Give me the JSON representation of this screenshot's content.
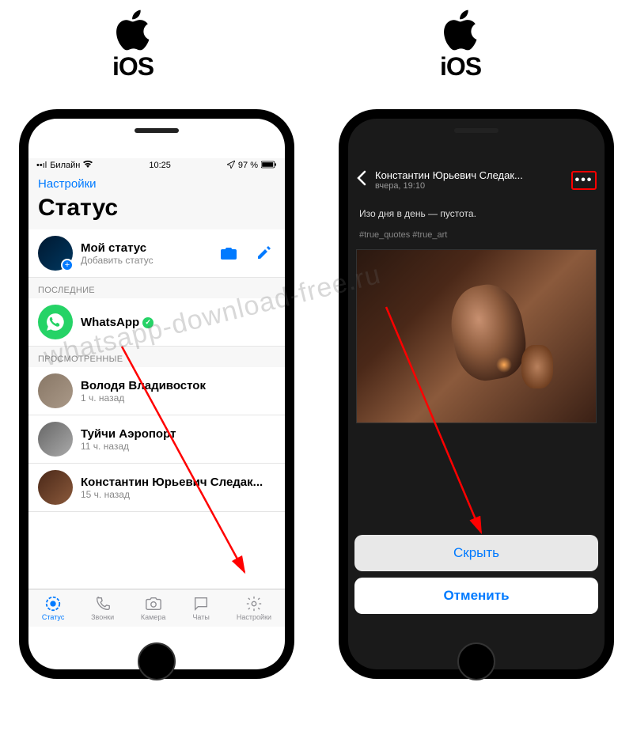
{
  "labels": {
    "ios": "iOS"
  },
  "left": {
    "status": {
      "carrier": "Билайн",
      "time": "10:25",
      "battery": "97 %"
    },
    "nav_link": "Настройки",
    "title": "Статус",
    "my_status": {
      "title": "Мой статус",
      "sub": "Добавить статус"
    },
    "sections": {
      "recent": "ПОСЛЕДНИЕ",
      "viewed": "ПРОСМОТРЕННЫЕ"
    },
    "whatsapp": {
      "title": "WhatsApp"
    },
    "viewed": [
      {
        "name": "Володя Владивосток",
        "time": "1 ч. назад"
      },
      {
        "name": "Туйчи Аэропорт",
        "time": "11 ч. назад"
      },
      {
        "name": "Константин Юрьевич Следак...",
        "time": "15 ч. назад"
      }
    ],
    "tabs": [
      "Статус",
      "Звонки",
      "Камера",
      "Чаты",
      "Настройки"
    ]
  },
  "right": {
    "header": {
      "name": "Константин Юрьевич Следак...",
      "time": "вчера, 19:10"
    },
    "caption": "Изо дня в день — пустота.",
    "tags": "#true_quotes #true_art",
    "actions": {
      "hide": "Скрыть",
      "cancel": "Отменить"
    }
  },
  "watermark": "whatsapp-download-free.ru"
}
